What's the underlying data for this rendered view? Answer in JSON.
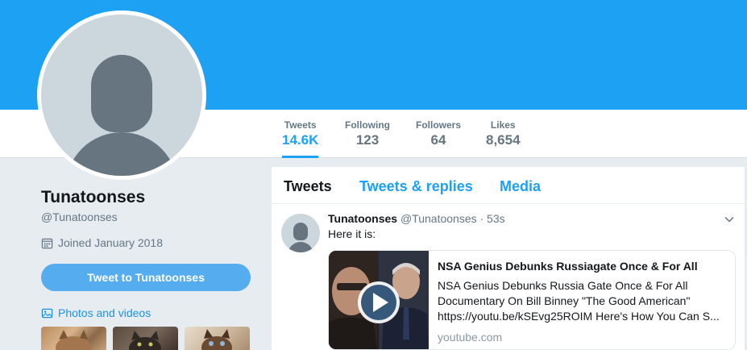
{
  "profile": {
    "name": "Tunatoonses",
    "handle": "@Tunatoonses",
    "joined": "Joined January 2018",
    "tweet_to_label": "Tweet to Tunatoonses",
    "photos_label": "Photos and videos"
  },
  "stats": [
    {
      "label": "Tweets",
      "value": "14.6K",
      "active": true
    },
    {
      "label": "Following",
      "value": "123"
    },
    {
      "label": "Followers",
      "value": "64"
    },
    {
      "label": "Likes",
      "value": "8,654"
    }
  ],
  "timeline_tabs": [
    {
      "label": "Tweets",
      "active": true
    },
    {
      "label": "Tweets & replies"
    },
    {
      "label": "Media"
    }
  ],
  "tweet": {
    "name": "Tunatoonses",
    "handle": "@Tunatoonses",
    "time": "· 53s",
    "text": "Here it is:",
    "card": {
      "title": "NSA Genius Debunks Russiagate Once & For All",
      "desc_line1": "NSA Genius Debunks Russia Gate Once & For All",
      "desc_line2": "Documentary On Bill Binney \"The Good American\"",
      "desc_line3": "https://youtu.be/kSEvg25ROIM Here's How You Can S...",
      "domain": "youtube.com"
    }
  },
  "colors": {
    "accent": "#1da1f2",
    "button": "#55acee",
    "link": "#1b95e0",
    "muted": "#657786"
  },
  "icons": [
    "calendar-icon",
    "photo-icon",
    "chevron-down-icon",
    "play-icon",
    "default-avatar-icon"
  ]
}
